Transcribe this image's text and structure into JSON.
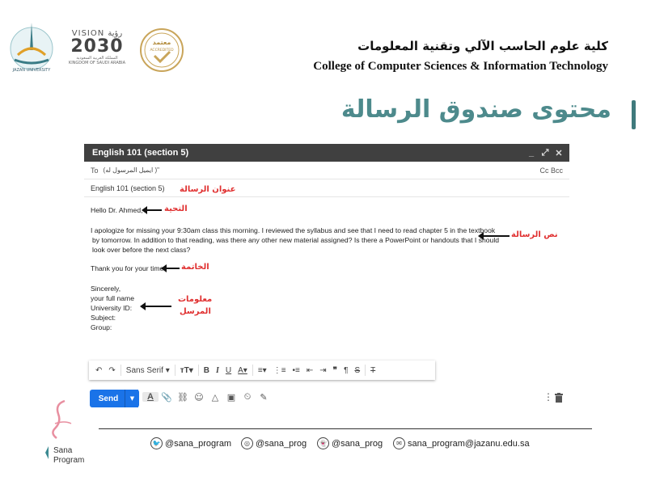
{
  "header": {
    "vision_top": "VISION رؤية",
    "vision_year": "2030",
    "vision_sub_ar": "المملكة العربية السعودية",
    "vision_sub_en": "KINGDOM OF SAUDI ARABIA",
    "accr_ar": "معتمد",
    "accr_en": "ACCREDITED",
    "uni_badge": "JAZAN UNIVERSITY",
    "college_ar": "كلية علوم الحاسب الآلي وتقنية المعلومات",
    "college_en": "College of Computer Sciences & Information Technology"
  },
  "slide_title": "محتوى صندوق الرسالة",
  "compose": {
    "window_title": "English 101 (section 5)",
    "to_label": "To",
    "to_value": "(ايميل المرسول له )\"",
    "cc_bcc": "Cc Bcc",
    "subject": "English 101 (section 5)",
    "greeting": "Hello Dr. Ahmed,",
    "body_1": "I apologize for missing your 9:30am class this morning. I reviewed the syllabus and see that I need to read chapter 5 in the textbook",
    "body_2": "by tomorrow. In addition to that reading, was there any other new material assigned? Is there a PowerPoint or handouts that I should",
    "body_3": "look over before the next class?",
    "closing": "Thank you for your time.",
    "sig_1": "Sincerely,",
    "sig_2": "your full name",
    "sig_3": "University ID:",
    "sig_4": "Subject:",
    "sig_5": "Group:",
    "send_label": "Send",
    "font_label": "Sans Serif"
  },
  "annotations": {
    "subject": "عنوان الرسالة",
    "greeting": "التحية",
    "body": "نص الرسالة",
    "closing": "الخاتمة",
    "sender_1": "معلومات",
    "sender_2": "المرسل"
  },
  "footer": {
    "sana_1": "Sana",
    "sana_2": "Program",
    "twitter": "@sana_program",
    "instagram": "@sana_prog",
    "snapchat": "@sana_prog",
    "email": "sana_program@jazanu.edu.sa"
  },
  "colors": {
    "title": "#4d8a8c",
    "annotation": "#e03030",
    "send": "#1a73e8",
    "header_bar": "#404040"
  }
}
